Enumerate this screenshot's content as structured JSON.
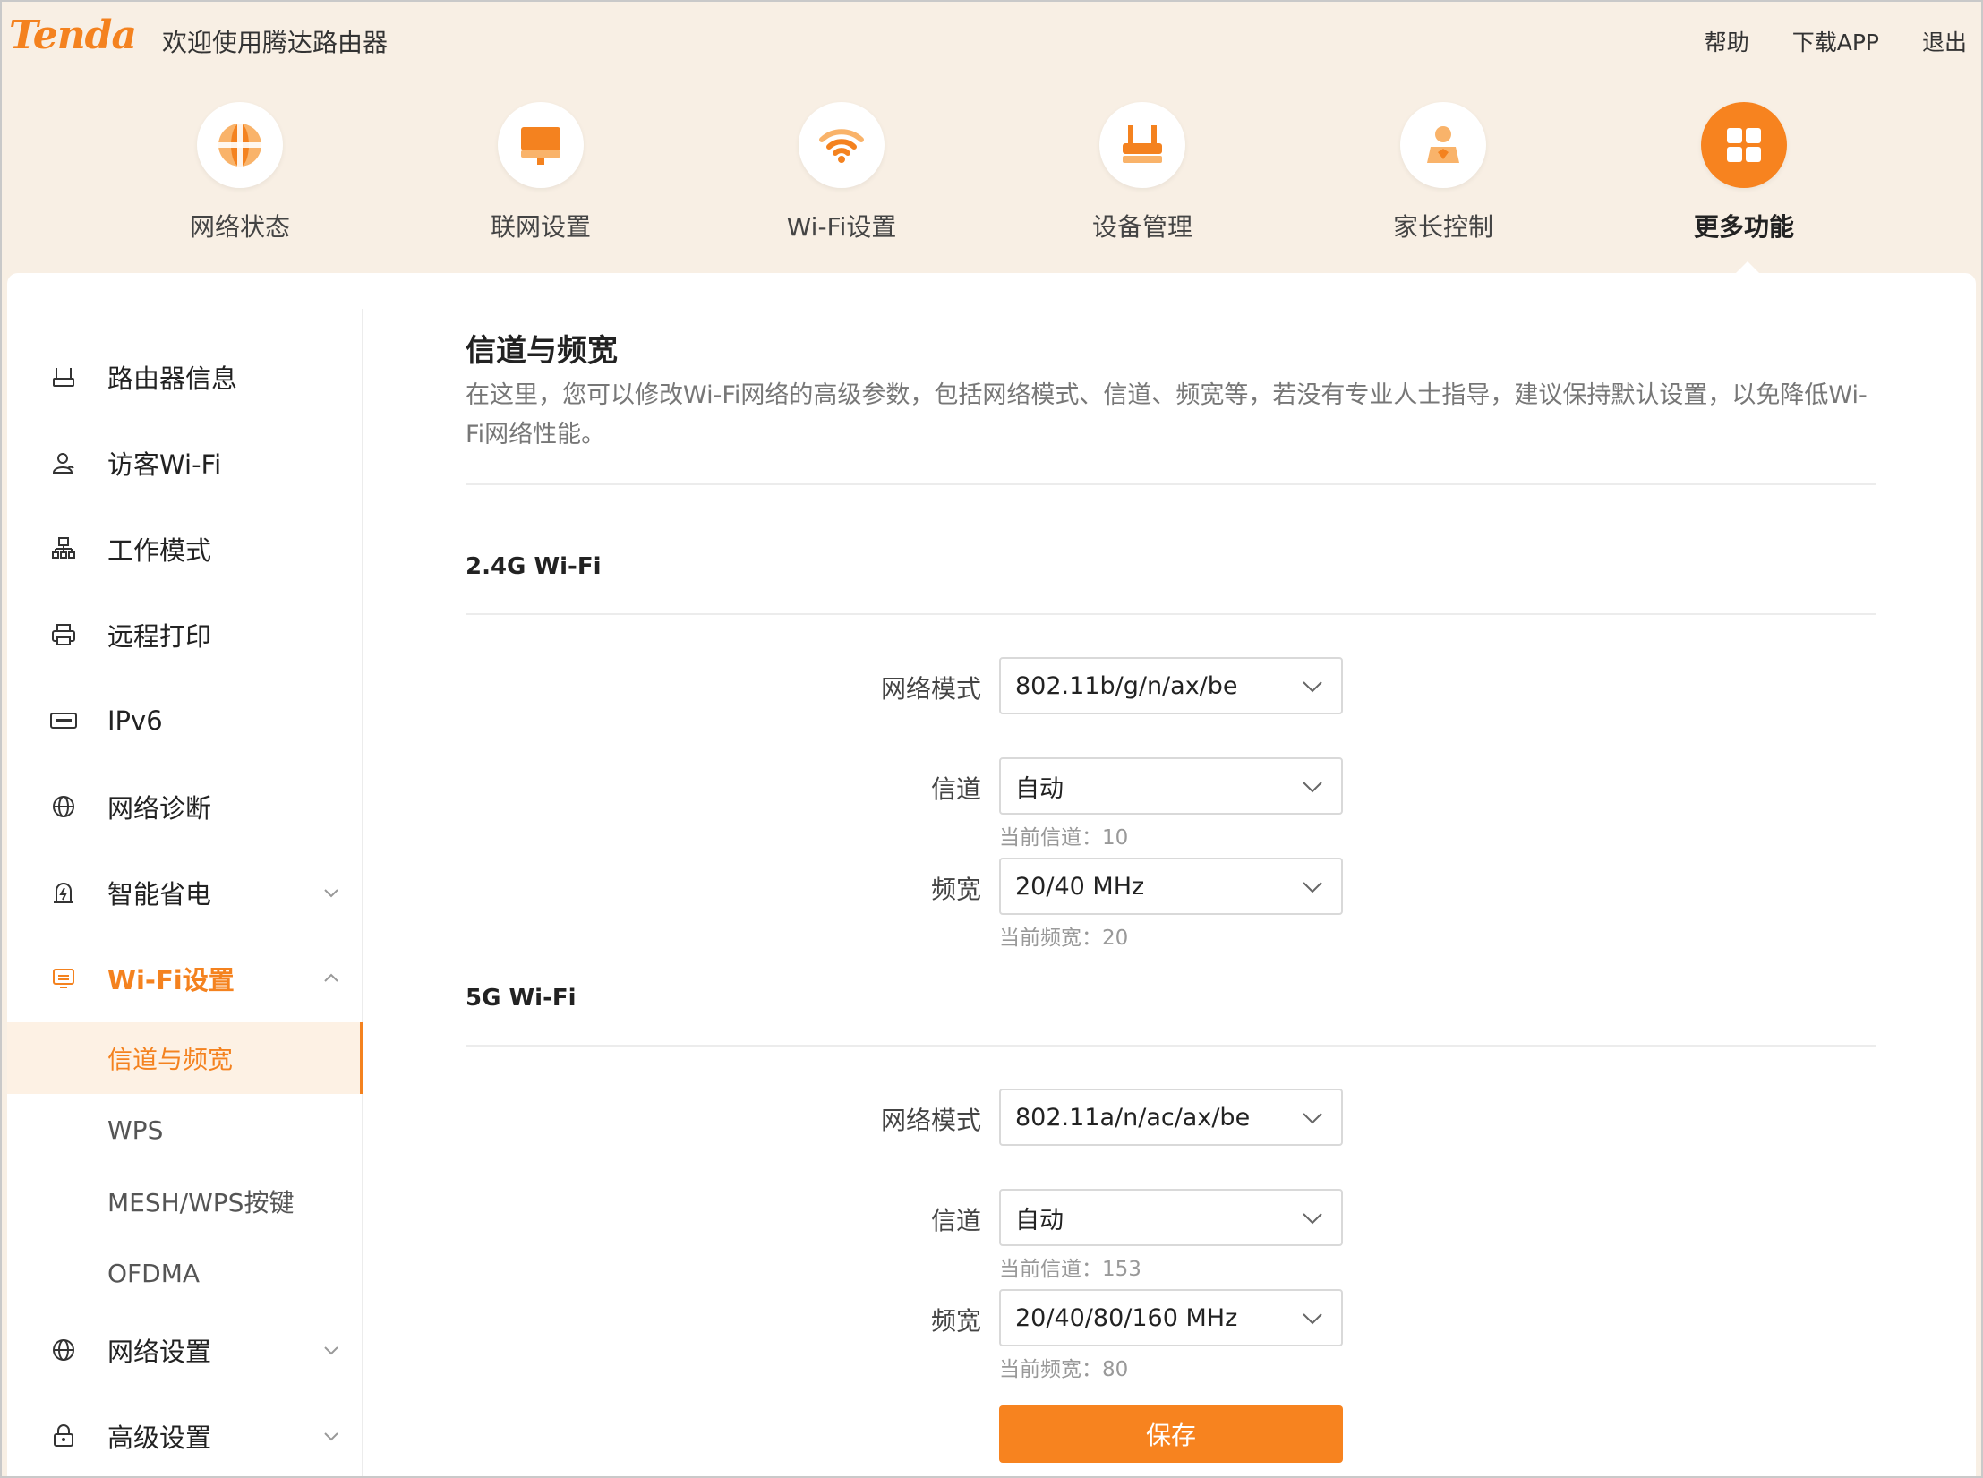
{
  "header": {
    "logo": "Tenda",
    "welcome": "欢迎使用腾达路由器",
    "links": [
      "帮助",
      "下载APP",
      "退出"
    ]
  },
  "colors": {
    "accent": "#f7831f",
    "page_bg": "#f8efe4"
  },
  "nav": {
    "items": [
      {
        "label": "网络状态",
        "icon": "globe-icon"
      },
      {
        "label": "联网设置",
        "icon": "monitor-icon"
      },
      {
        "label": "Wi-Fi设置",
        "icon": "wifi-icon"
      },
      {
        "label": "设备管理",
        "icon": "router-icon"
      },
      {
        "label": "家长控制",
        "icon": "parent-icon"
      },
      {
        "label": "更多功能",
        "icon": "grid-icon",
        "active": true
      }
    ]
  },
  "sidebar": {
    "items": [
      {
        "label": "路由器信息",
        "icon": "router-info-icon"
      },
      {
        "label": "访客Wi-Fi",
        "icon": "guest-icon"
      },
      {
        "label": "工作模式",
        "icon": "network-topology-icon"
      },
      {
        "label": "远程打印",
        "icon": "printer-icon"
      },
      {
        "label": "IPv6",
        "icon": "ipv6-icon"
      },
      {
        "label": "网络诊断",
        "icon": "globe-icon"
      },
      {
        "label": "智能省电",
        "icon": "power-save-icon",
        "expandable": true
      },
      {
        "label": "Wi-Fi设置",
        "icon": "wifi-settings-icon",
        "expandable": true,
        "open": true
      },
      {
        "label": "网络设置",
        "icon": "globe-icon",
        "expandable": true
      },
      {
        "label": "高级设置",
        "icon": "lock-icon",
        "expandable": true
      }
    ],
    "wifi_sub_items": [
      "信道与频宽",
      "WPS",
      "MESH/WPS按键",
      "OFDMA"
    ],
    "active_sub_item": "信道与频宽"
  },
  "main": {
    "title": "信道与频宽",
    "description": "在这里，您可以修改Wi-Fi网络的高级参数，包括网络模式、信道、频宽等，若没有专业人士指导，建议保持默认设置，以免降低Wi-Fi网络性能。",
    "sections": [
      {
        "title": "2.4G Wi-Fi",
        "mode_label": "网络模式",
        "mode_value": "802.11b/g/n/ax/be",
        "channel_label": "信道",
        "channel_value": "自动",
        "channel_hint": "当前信道：10",
        "bandwidth_label": "频宽",
        "bandwidth_value": "20/40 MHz",
        "bandwidth_hint": "当前频宽：20"
      },
      {
        "title": "5G Wi-Fi",
        "mode_label": "网络模式",
        "mode_value": "802.11a/n/ac/ax/be",
        "channel_label": "信道",
        "channel_value": "自动",
        "channel_hint": "当前信道：153",
        "bandwidth_label": "频宽",
        "bandwidth_value": "20/40/80/160 MHz",
        "bandwidth_hint": "当前频宽：80"
      }
    ],
    "save_label": "保存"
  }
}
